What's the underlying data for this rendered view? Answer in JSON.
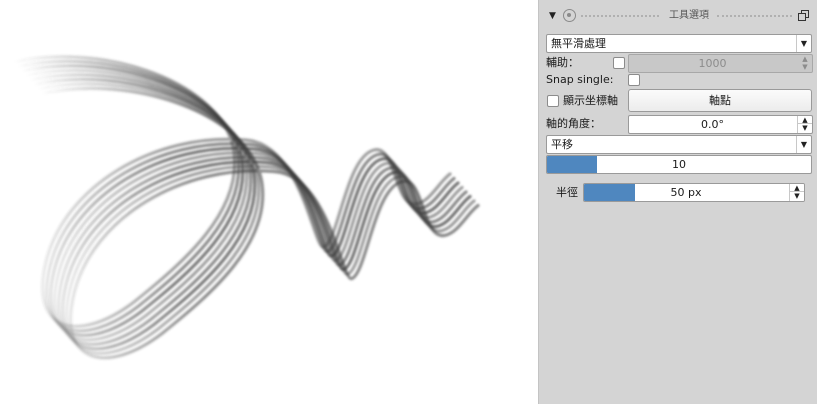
{
  "panel": {
    "title": "工具選項",
    "collapse_icon": "triangle-down",
    "target_icon": "target-circle",
    "float_icon": "float-window",
    "smoothing": {
      "value": "無平滑處理"
    },
    "assistant": {
      "label": "輔助：",
      "value": "1000",
      "checked": false,
      "disabled": true
    },
    "snap_single": {
      "label": "Snap single:",
      "checked": false
    },
    "show_axis": {
      "label": "顯示坐標軸",
      "checked": false
    },
    "axis_point_button": "軸點",
    "axis_angle": {
      "label": "軸的角度：",
      "value": "0.0°"
    },
    "mode": {
      "value": "平移"
    },
    "count_slider": {
      "value": "10",
      "fraction": 0.19
    },
    "radius": {
      "label": "半徑",
      "value": "50 px",
      "fraction": 0.25
    }
  },
  "colors": {
    "panel_bg": "#d4d4d4",
    "slider_fill": "#4f87bf",
    "stroke": "#3c3c3c"
  }
}
